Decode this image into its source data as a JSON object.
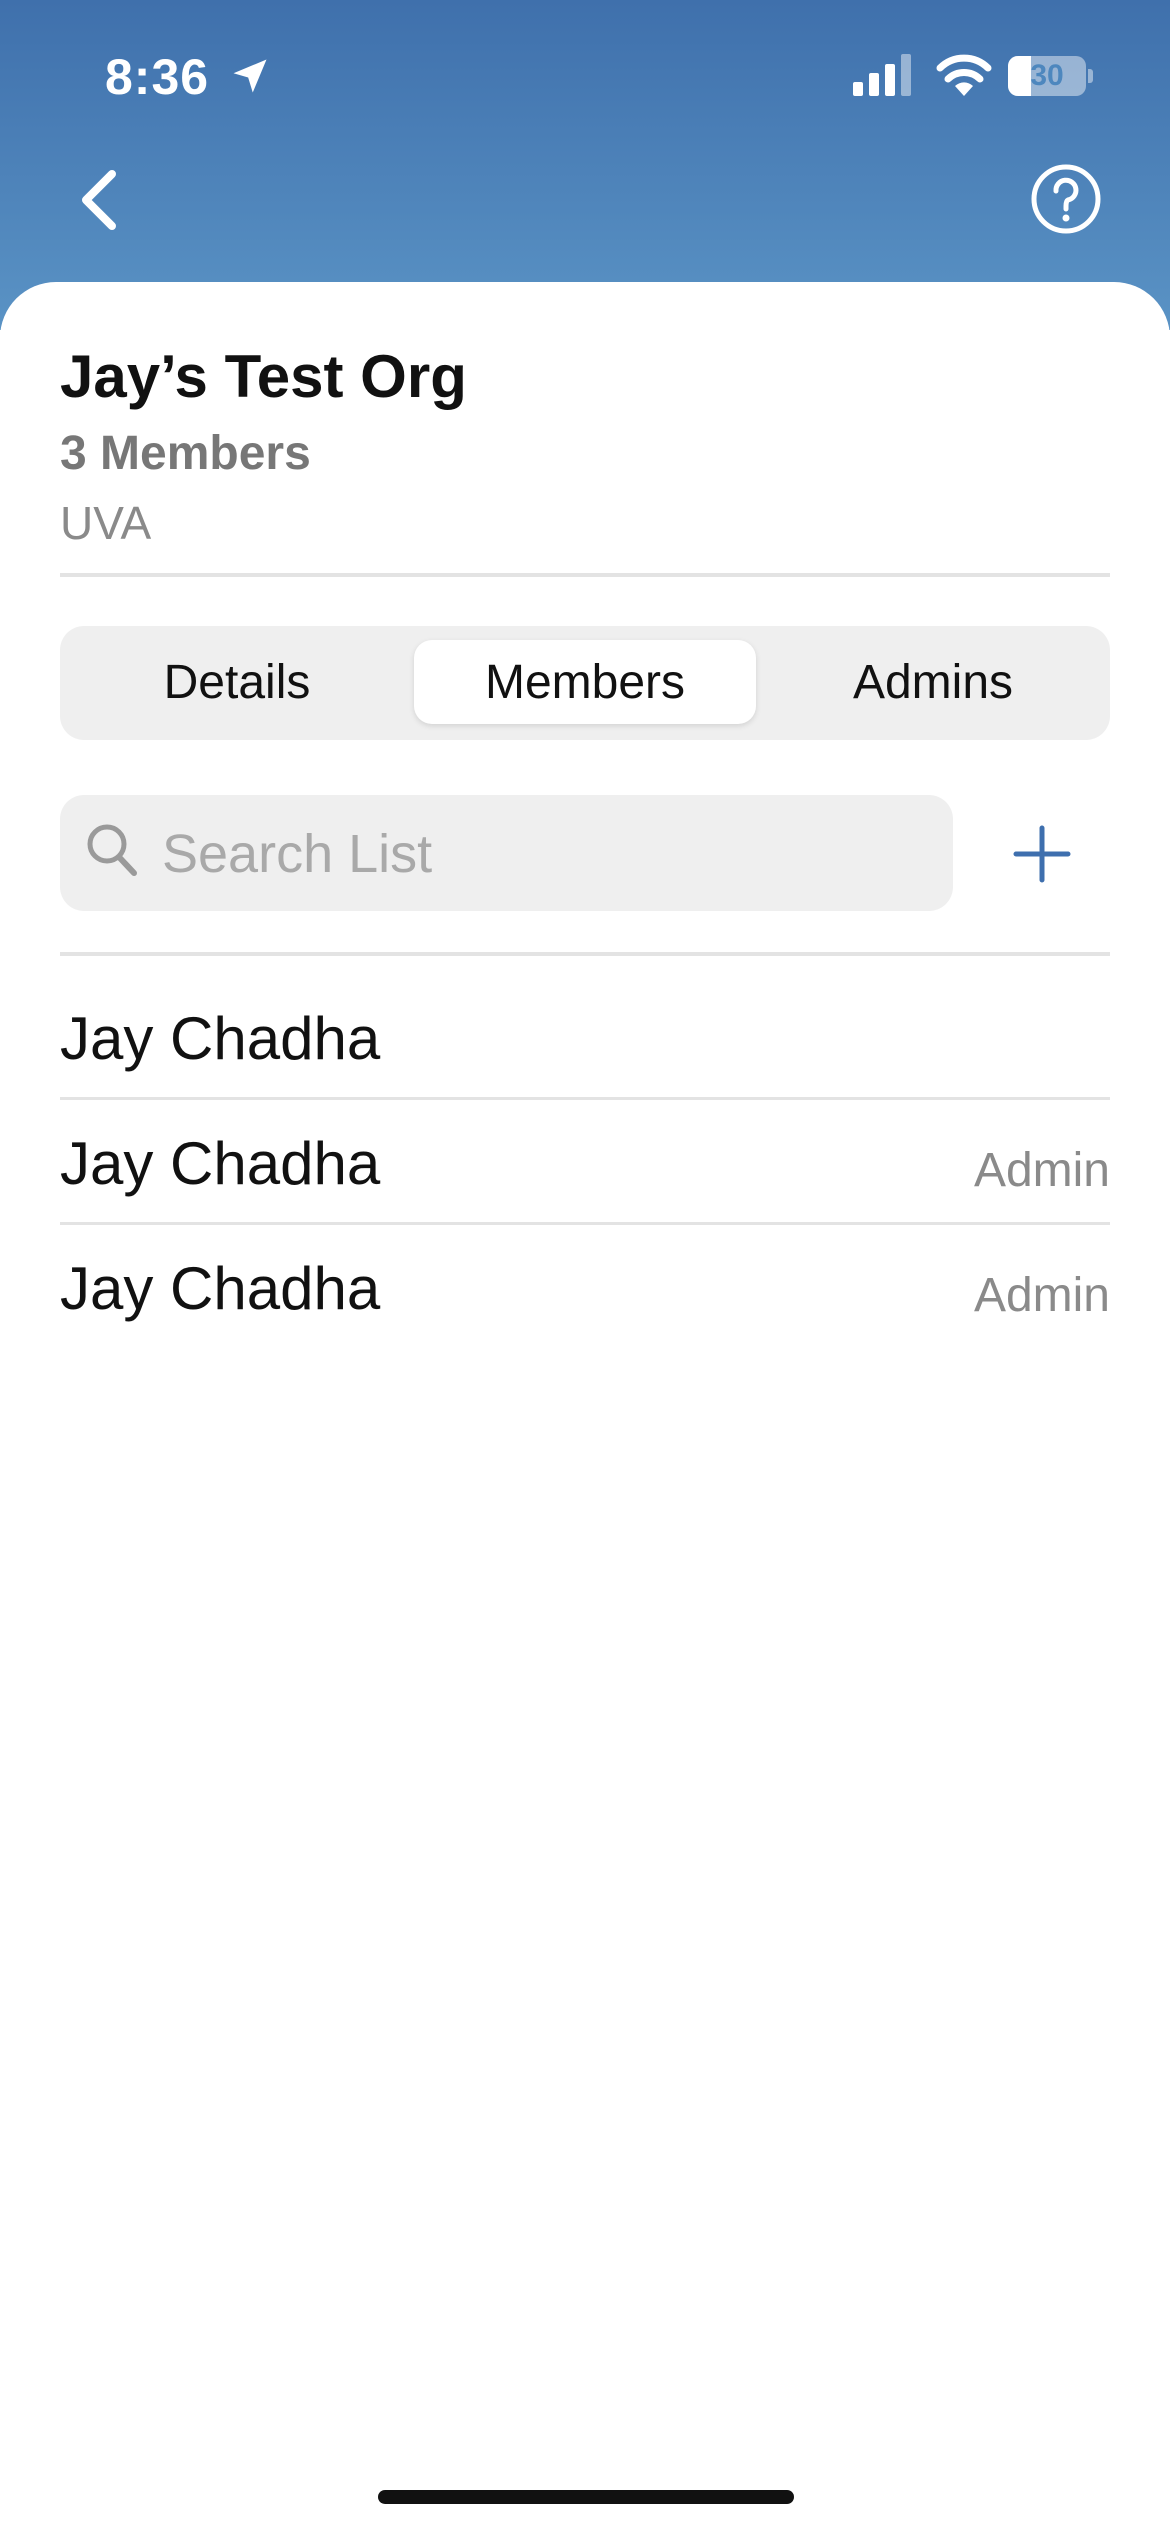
{
  "status_bar": {
    "time": "8:36",
    "battery_percent": "30",
    "battery_level": 0.3
  },
  "nav": {
    "back_icon": "chevron-left-icon",
    "help_icon": "question-circle-icon"
  },
  "org": {
    "name": "Jay’s Test Org",
    "member_count": "3 Members",
    "school": "UVA"
  },
  "tabs": [
    {
      "label": "Details",
      "active": false
    },
    {
      "label": "Members",
      "active": true
    },
    {
      "label": "Admins",
      "active": false
    }
  ],
  "search": {
    "placeholder": "Search List",
    "value": ""
  },
  "add_icon": "plus-icon",
  "members": [
    {
      "name": "Jay Chadha",
      "role": ""
    },
    {
      "name": "Jay Chadha",
      "role": "Admin"
    },
    {
      "name": "Jay Chadha",
      "role": "Admin"
    }
  ],
  "colors": {
    "header_top": "#3f70ac",
    "header_bottom": "#5a93c5",
    "accent": "#3e6fae"
  }
}
